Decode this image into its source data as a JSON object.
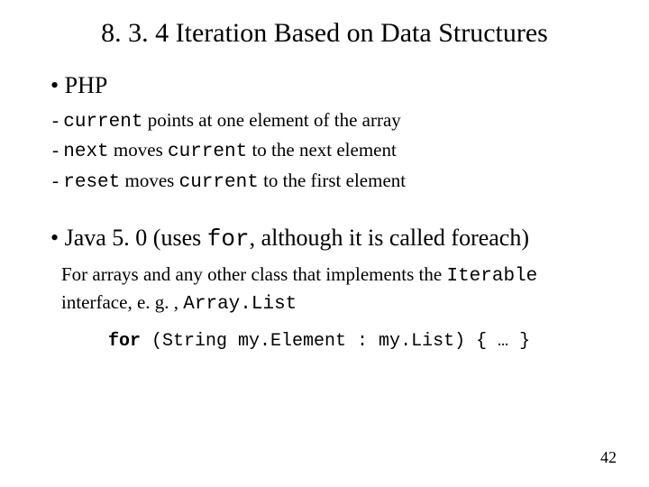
{
  "title": "8. 3. 4 Iteration Based on Data Structures",
  "bullet1": "•  PHP",
  "sub1_pre": "- ",
  "sub1_c1": "current",
  "sub1_post": " points at one element of the array",
  "sub2_pre": "- ",
  "sub2_c1": "next",
  "sub2_mid": " moves ",
  "sub2_c2": "current",
  "sub2_post": " to the next element",
  "sub3_pre": "- ",
  "sub3_c1": "reset",
  "sub3_mid": " moves ",
  "sub3_c2": "current",
  "sub3_post": " to the first element",
  "bullet2_pre": "•  Java 5. 0 (uses ",
  "bullet2_code": "for",
  "bullet2_post": ", although it is called foreach)",
  "desc2_pre": "For arrays and any other class that implements the ",
  "desc2_code1": "Iterable",
  "desc2_mid": " interface, e. g. , ",
  "desc2_code2": "Array.List",
  "code_kw": "for",
  "code_rest": " (String my.Element : my.List) { … }",
  "pageNumber": "42"
}
